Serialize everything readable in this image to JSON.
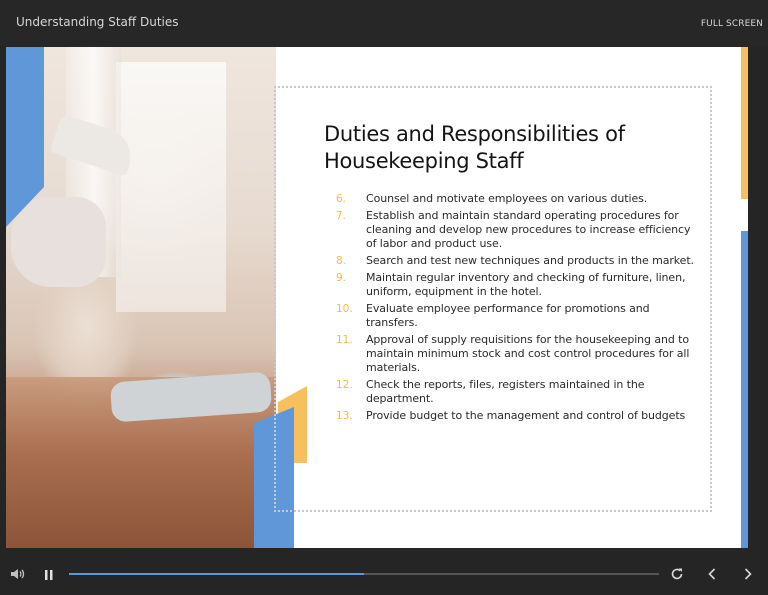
{
  "app": {
    "title": "Understanding Staff Duties",
    "fullscreen_label": "FULL SCREEN"
  },
  "slide": {
    "heading": "Duties and Responsibilities of Housekeeping Staff",
    "items": [
      {
        "num": "6.",
        "text": "Counsel and motivate employees on various duties."
      },
      {
        "num": "7.",
        "text": "Establish and maintain standard operating procedures for cleaning and develop new procedures to increase efficiency of labor and product use."
      },
      {
        "num": "8.",
        "text": "Search and test new techniques and products in the market."
      },
      {
        "num": "9.",
        "text": "Maintain regular inventory and checking of furniture, linen, uniform, equipment in the hotel."
      },
      {
        "num": "10.",
        "text": "Evaluate employee performance for promotions and transfers."
      },
      {
        "num": "11.",
        "text": "Approval of supply requisitions for the housekeeping and to maintain minimum stock and cost control procedures for all materials."
      },
      {
        "num": "12.",
        "text": "Check the reports, files, registers maintained in the department."
      },
      {
        "num": "13.",
        "text": "Provide budget to the management and control of budgets"
      }
    ]
  },
  "player": {
    "progress": 0.5,
    "icons": [
      "volume-icon",
      "pause-icon",
      "replay-icon",
      "previous-icon",
      "next-icon"
    ]
  },
  "colors": {
    "accent_blue": "#5f97d9",
    "accent_yellow": "#f7c05e",
    "number_color": "#f4b84f",
    "background": "#252525"
  }
}
